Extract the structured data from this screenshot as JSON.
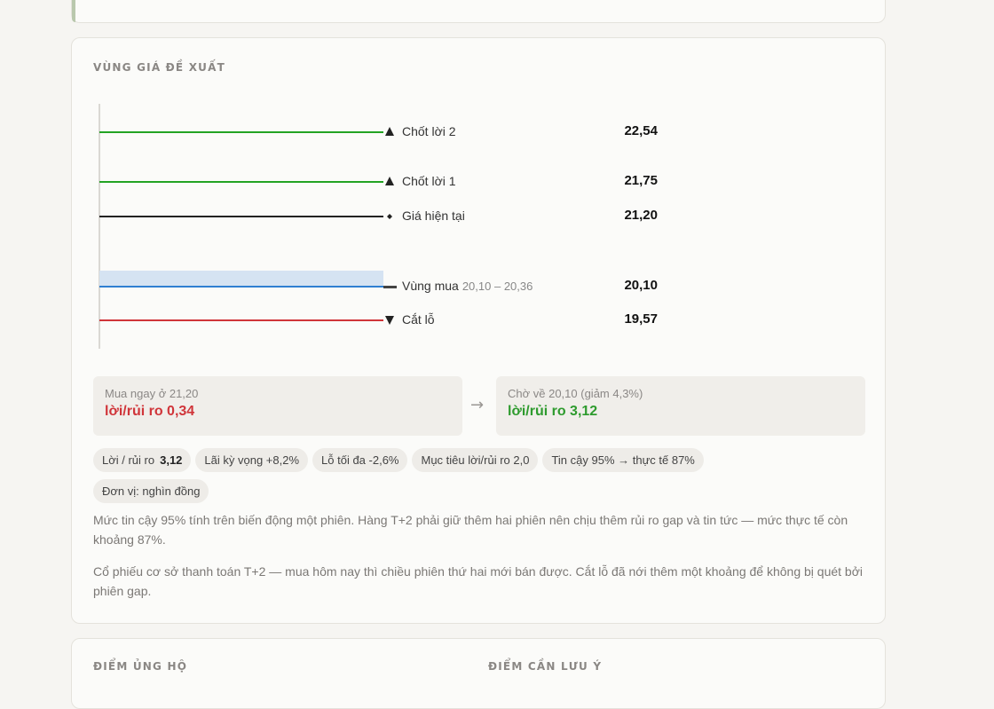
{
  "section_title": "VÙNG GIÁ ĐỀ XUẤT",
  "price_levels": [
    {
      "label": "Chốt lời 2",
      "marker": "triangle-up-icon",
      "value": "22,54",
      "color": "#23a323"
    },
    {
      "label": "Chốt lời 1",
      "marker": "triangle-up-icon",
      "value": "21,75",
      "color": "#23a323"
    },
    {
      "label": "Giá hiện tại",
      "marker": "diamond-icon",
      "value": "21,20",
      "color": "#222222"
    },
    {
      "label": "Vùng mua",
      "range": "20,10 – 20,36",
      "marker": "dash-icon",
      "value": "20,10",
      "color": "#2f7fd1"
    },
    {
      "label": "Cắt lỗ",
      "marker": "triangle-down-icon",
      "value": "19,57",
      "color": "#d0353a"
    }
  ],
  "buy_now": {
    "caption": "Mua ngay ở 21,20",
    "ratio": "lời/rủi ro 0,34",
    "color": "#d0353a"
  },
  "arrow": "→",
  "wait": {
    "caption": "Chờ về 20,10 (giảm 4,3%)",
    "ratio": "lời/rủi ro 3,12",
    "color": "#2e9b2e"
  },
  "pills": [
    {
      "label": "Lời / rủi ro",
      "value": "3,12"
    },
    {
      "label": "Lãi kỳ vọng +8,2%"
    },
    {
      "label": "Lỗ tối đa -2,6%"
    },
    {
      "label": "Mục tiêu lời/rủi ro 2,0"
    },
    {
      "label": "Tin cậy 95% → thực tế 87%"
    },
    {
      "label": "Đơn vị: nghìn đồng"
    }
  ],
  "paragraphs": [
    "Mức tin cậy 95% tính trên biến động một phiên. Hàng T+2 phải giữ thêm hai phiên nên chịu thêm rủi ro gap và tin tức — mức thực tế còn khoảng 87%.",
    "Cổ phiếu cơ sở thanh toán T+2 — mua hôm nay thì chiều phiên thứ hai mới bán được. Cắt lỗ đã nới thêm một khoảng để không bị quét bởi phiên gap."
  ],
  "bottom": {
    "left_title": "ĐIỂM ỦNG HỘ",
    "right_title": "ĐIỂM CẦN LƯU Ý"
  }
}
